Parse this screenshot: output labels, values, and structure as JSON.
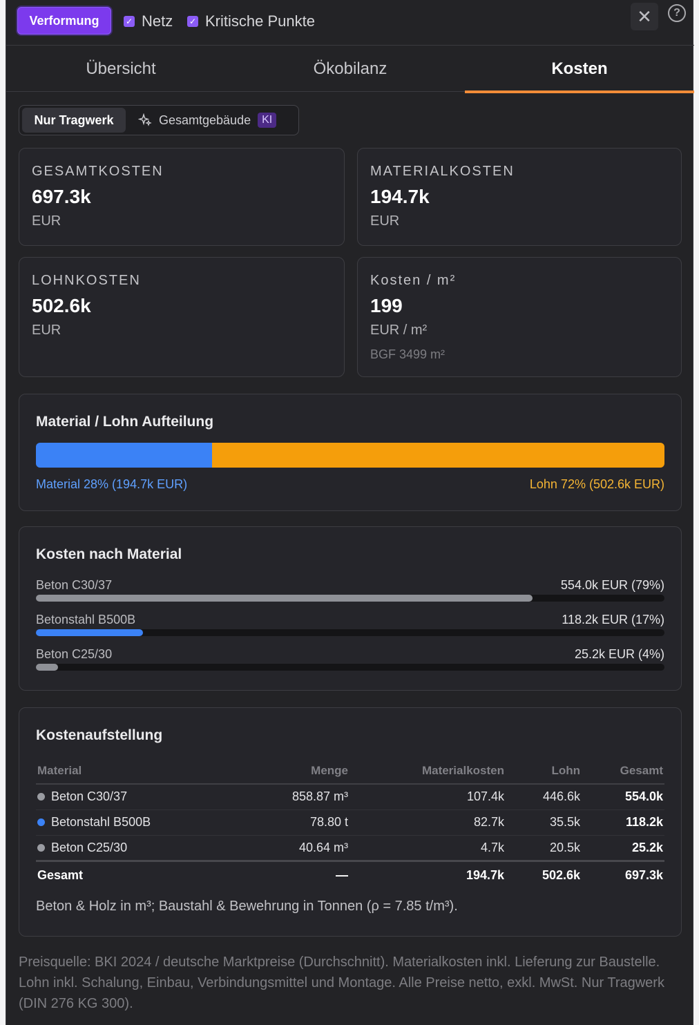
{
  "topbar": {
    "deform_label": "Verformung",
    "netz_label": "Netz",
    "kritisch_label": "Kritische Punkte",
    "close_glyph": "✕",
    "help_glyph": "?"
  },
  "tabs": [
    {
      "label": "Übersicht",
      "active": false
    },
    {
      "label": "Ökobilanz",
      "active": false
    },
    {
      "label": "Kosten",
      "active": true
    }
  ],
  "scope": {
    "option1": "Nur Tragwerk",
    "option2": "Gesamtgebäude",
    "ki_badge": "KI"
  },
  "stats": {
    "gesamt": {
      "label": "Gesamtkosten",
      "value": "697.3k",
      "unit": "EUR"
    },
    "material": {
      "label": "Materialkosten",
      "value": "194.7k",
      "unit": "EUR"
    },
    "lohn": {
      "label": "Lohnkosten",
      "value": "502.6k",
      "unit": "EUR"
    },
    "m2": {
      "label": "Kosten / m²",
      "value": "199",
      "unit": "EUR / m²",
      "sub": "BGF 3499 m²"
    }
  },
  "split": {
    "title": "Material / Lohn Aufteilung",
    "material_fraction": 0.28,
    "material_label": "Material 28% (194.7k EUR)",
    "lohn_label": "Lohn 72% (502.6k EUR)"
  },
  "by_material": {
    "title": "Kosten nach Material",
    "rows": [
      {
        "name": "Beton C30/37",
        "value": "554.0k EUR (79%)",
        "fraction": 0.79,
        "color": "#8f9197"
      },
      {
        "name": "Betonstahl B500B",
        "value": "118.2k EUR (17%)",
        "fraction": 0.17,
        "color": "#3b82f6"
      },
      {
        "name": "Beton C25/30",
        "value": "25.2k EUR (4%)",
        "fraction": 0.035,
        "color": "#8f9197"
      }
    ]
  },
  "breakdown": {
    "title": "Kostenaufstellung",
    "headers": [
      "Material",
      "Menge",
      "Materialkosten",
      "Lohn",
      "Gesamt"
    ],
    "rows": [
      {
        "material": "Beton C30/37",
        "dot": "#9a9ca2",
        "menge": "858.87 m³",
        "mat": "107.4k",
        "lohn": "446.6k",
        "gesamt": "554.0k"
      },
      {
        "material": "Betonstahl B500B",
        "dot": "#3b82f6",
        "menge": "78.80 t",
        "mat": "82.7k",
        "lohn": "35.5k",
        "gesamt": "118.2k"
      },
      {
        "material": "Beton C25/30",
        "dot": "#9a9ca2",
        "menge": "40.64 m³",
        "mat": "4.7k",
        "lohn": "20.5k",
        "gesamt": "25.2k"
      }
    ],
    "total": {
      "label": "Gesamt",
      "menge": "—",
      "mat": "194.7k",
      "lohn": "502.6k",
      "gesamt": "697.3k"
    },
    "note": "Beton & Holz in m³; Baustahl & Bewehrung in Tonnen (ρ = 7.85 t/m³)."
  },
  "footer": "Preisquelle: BKI 2024 / deutsche Marktpreise (Durchschnitt). Materialkosten inkl. Lieferung zur Baustelle. Lohn inkl. Schalung, Einbau, Verbindungsmittel und Montage. Alle Preise netto, exkl. MwSt. Nur Tragwerk (DIN 276 KG 300)."
}
